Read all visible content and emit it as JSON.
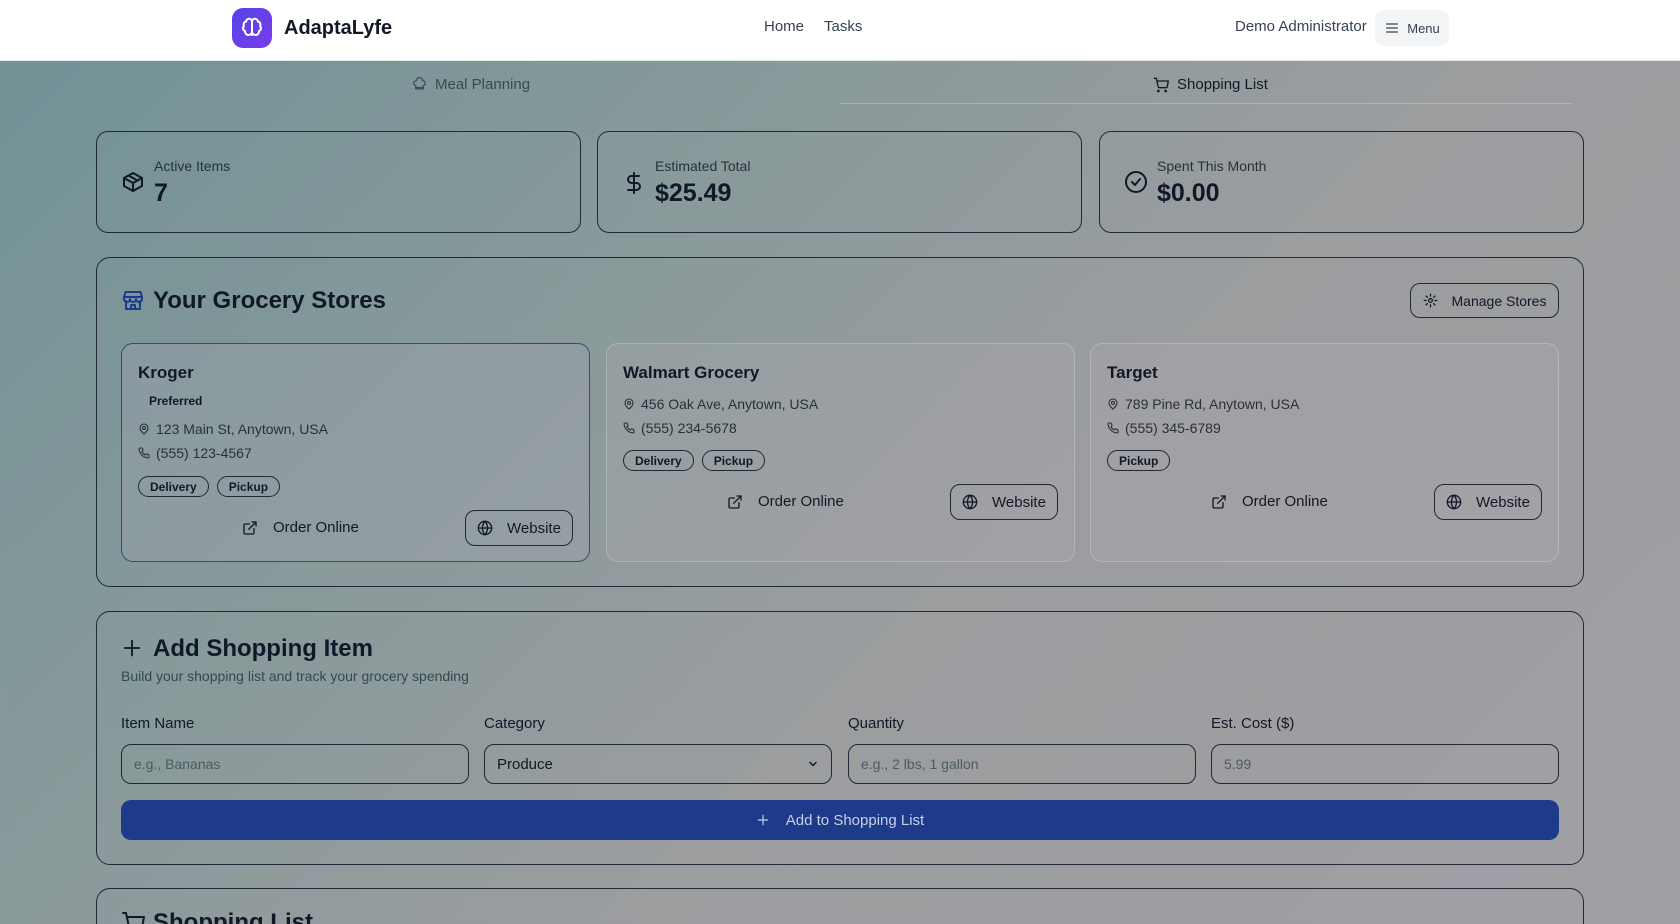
{
  "header": {
    "app_name": "AdaptaLyfe",
    "nav": [
      "Home",
      "Tasks"
    ],
    "user": "Demo Administrator",
    "menu_label": "Menu"
  },
  "tabs": {
    "meal": "Meal Planning",
    "shopping": "Shopping List"
  },
  "stats": [
    {
      "label": "Active Items",
      "value": "7",
      "icon": "package-icon"
    },
    {
      "label": "Estimated Total",
      "value": "$25.49",
      "icon": "dollar-icon"
    },
    {
      "label": "Spent This Month",
      "value": "$0.00",
      "icon": "check-circle-icon"
    }
  ],
  "stores_section": {
    "title": "Your Grocery Stores",
    "manage_label": "Manage Stores",
    "order_label": "Order Online",
    "website_label": "Website",
    "stores": [
      {
        "name": "Kroger",
        "badge": "Preferred",
        "address": "123 Main St, Anytown, USA",
        "phone": "(555) 123-4567",
        "services": [
          "Delivery",
          "Pickup"
        ]
      },
      {
        "name": "Walmart Grocery",
        "address": "456 Oak Ave, Anytown, USA",
        "phone": "(555) 234-5678",
        "services": [
          "Delivery",
          "Pickup"
        ]
      },
      {
        "name": "Target",
        "address": "789 Pine Rd, Anytown, USA",
        "phone": "(555) 345-6789",
        "services": [
          "Pickup"
        ]
      }
    ]
  },
  "add_item": {
    "title": "Add Shopping Item",
    "subtitle": "Build your shopping list and track your grocery spending",
    "fields": {
      "name_label": "Item Name",
      "name_placeholder": "e.g., Bananas",
      "category_label": "Category",
      "category_value": "Produce",
      "quantity_label": "Quantity",
      "quantity_placeholder": "e.g., 2 lbs, 1 gallon",
      "cost_label": "Est. Cost ($)",
      "cost_placeholder": "5.99"
    },
    "submit_label": "Add to Shopping List"
  },
  "shopping_list": {
    "title": "Shopping List"
  }
}
